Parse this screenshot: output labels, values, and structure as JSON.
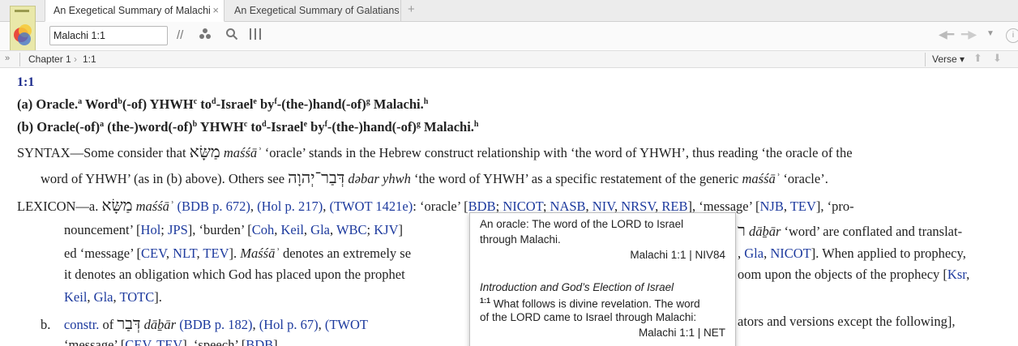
{
  "tabs": [
    {
      "label": "An Exegetical Summary of Malachi",
      "close": "×"
    },
    {
      "label": "An Exegetical Summary of Galatians"
    }
  ],
  "new_tab": "+",
  "toolbar": {
    "reference_value": "Malachi 1:1"
  },
  "breadcrumb": {
    "expand": "»",
    "chapter": "Chapter 1",
    "separator": "›",
    "verse": "1:1",
    "mode": "Verse ▾"
  },
  "document": {
    "verse_ref": "1:1",
    "a": {
      "p1": "(a) Oracle.",
      "s1": "a",
      "p2": " Word",
      "s2": "b",
      "p3": "(-of) YHWH",
      "s3": "c",
      "p4": " to",
      "s4": "d",
      "p5": "-Israel",
      "s5": "e",
      "p6": " by",
      "s6": "f",
      "p7": "-(the-)hand(-of)",
      "s7": "g",
      "p8": " Malachi.",
      "s8": "h"
    },
    "b": {
      "p1": "(b) Oracle(-of)",
      "s1": "a",
      "p2": " (the-)word(-of)",
      "s2": "b",
      "p3": " YHWH",
      "s3": "c",
      "p4": " to",
      "s4": "d",
      "p5": "-Israel",
      "s5": "e",
      "p6": " by",
      "s6": "f",
      "p7": "-(the-)hand(-of)",
      "s7": "g",
      "p8": " Malachi.",
      "s8": "h"
    },
    "syntax": {
      "l1a": "SYNTAX—Some consider that ",
      "heb1": "מַשָּׂא",
      "tr1": " maśśāʾ",
      "l1b": " ‘oracle’ stands in the Hebrew construct relationship with ‘the word of YHWH’, thus reading ‘the oracle of the",
      "l2a": "word of YHWH’ (as in (b) above). Others see ",
      "heb2": "דְּבַר־יְהוָה",
      "tr2": " dəbar yhwh",
      "l2b": " ‘the word of YHWH’ as a specific restatement of the generic ",
      "tr3": "maśśāʾ",
      "l2c": " ‘oracle’."
    },
    "lexicon": {
      "l1a": "LEXICON—a. ",
      "heb1": "מַשָּׂא",
      "tr1": " maśśāʾ",
      "bdb": "(BDB p. 672)",
      "hol": "(Hol p. 217)",
      "twot": "(TWOT 1421e)",
      "l1b": ": ‘oracle’ [",
      "r_bdb": "BDB",
      "r_nicot": "NICOT",
      "r_nasb": "NASB",
      "r_niv": "NIV",
      "r_nrsv": "NRSV",
      "r_reb": "REB",
      "l1c": "], ‘message’ [",
      "r_njb": "NJB",
      "r_tev": "TEV",
      "l1d": "], ‘pro-",
      "l2a": "nouncement’ [",
      "r_hol": "Hol",
      "r_jps": "JPS",
      "l2b": "], ‘burden’ [",
      "r_coh": "Coh",
      "r_keil": "Keil",
      "r_gla": "Gla",
      "r_wbc": "WBC",
      "r_kjv": "KJV",
      "l2c": "]",
      "l2r_heb": "ר",
      "l2r_tr": " dāḇār",
      "l2r_txt": " ‘word’ are conflated and translat-",
      "l3a": "ed ‘message’ [",
      "r_cev": "CEV",
      "r_nlt": "NLT",
      "r_tev2": "TEV",
      "l3b": "]. ",
      "tr4": "Maśśāʾ",
      "l3c": " denotes an extremely se",
      "l3r_a": ", ",
      "r_gla2": "Gla",
      "r_nicot2": "NICOT",
      "l3r_b": "]. When applied to prophecy,",
      "l4a": "it denotes an obligation which God has placed upon the prophet ",
      "l4r": "oom upon the objects of the prophecy [",
      "r_ksr": "Ksr",
      "l5a": "Keil",
      "r_gla3": "Gla",
      "r_totc": "TOTC",
      "l5b": "].",
      "b_label": "b.",
      "constr": "constr.",
      "of": " of ",
      "heb_dbr": "דְּבַר",
      "tr_dbr": " dāḇār",
      "bdb2": "(BDB p. 182)",
      "hol2": "(Hol p. 67)",
      "twot2": "(TWOT",
      "b_right": "ators and versions except the following],",
      "l7a": "‘message’ [",
      "r_cev2": "CEV",
      "r_tev3": "TEV",
      "l7b": "], ‘speech’ [",
      "r_bdb2": "BDB",
      "l7c": "]"
    }
  },
  "popup": {
    "niv_line1": "An oracle: The word of the LORD to Israel",
    "niv_line2": "through Malachi.",
    "niv_ref": "Malachi 1:1 | NIV84",
    "net_heading": "Introduction and God’s Election of Israel",
    "net_verse": "1:1",
    "net_line1": " What follows is divine revelation. The word",
    "net_line2": "of the LORD came to Israel through Malachi:",
    "net_ref": "Malachi 1:1 | NET"
  }
}
